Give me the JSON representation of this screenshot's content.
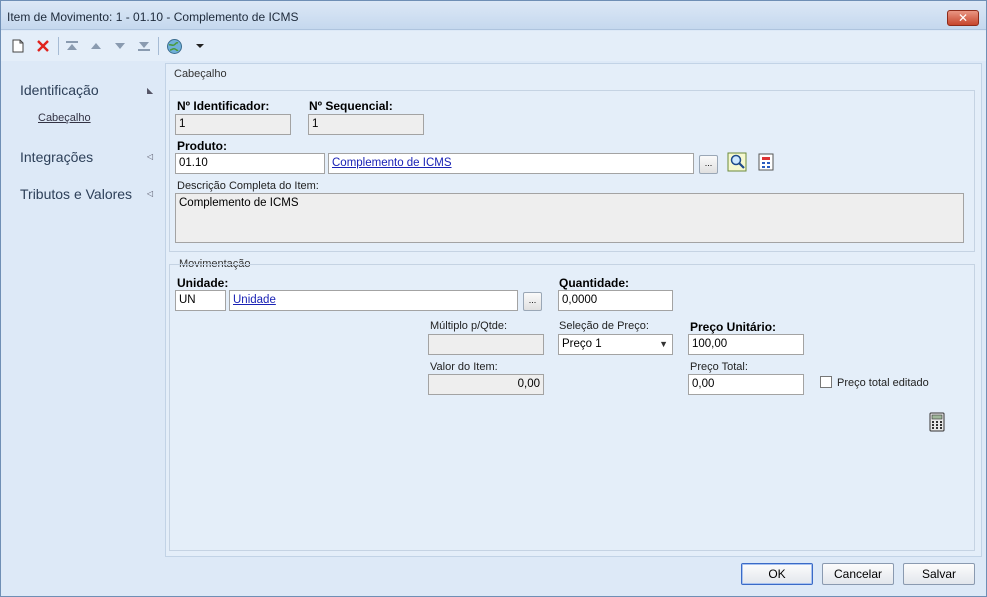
{
  "window": {
    "title": "Item de Movimento: 1 - 01.10 - Complemento de ICMS",
    "close_label": "✕"
  },
  "toolbar": {
    "items": [
      "new-document-icon",
      "delete-icon",
      "first-record-icon",
      "previous-record-icon",
      "next-record-icon",
      "last-record-icon",
      "globe-icon",
      "dropdown-arrow-icon"
    ]
  },
  "sidebar": {
    "items": [
      {
        "label": "Identificação",
        "sub": "Cabeçalho"
      },
      {
        "label": "Integrações"
      },
      {
        "label": "Tributos e Valores"
      }
    ]
  },
  "cabecalho": {
    "group_label": "Cabeçalho",
    "identificador_label": "Nº Identificador:",
    "identificador_value": "1",
    "sequencial_label": "Nº Sequencial:",
    "sequencial_value": "1",
    "produto_label": "Produto:",
    "produto_code": "01.10",
    "produto_name": "Complemento de ICMS",
    "lookup_label": "...",
    "descricao_label": "Descrição Completa do Item:",
    "descricao_value": "Complemento de ICMS"
  },
  "movimentacao": {
    "group_label": "Movimentação",
    "unidade_label": "Unidade:",
    "unidade_code": "UN",
    "unidade_name": "Unidade",
    "lookup_label": "...",
    "quantidade_label": "Quantidade:",
    "quantidade_value": "0,0000",
    "multiplo_label": "Múltiplo p/Qtde:",
    "multiplo_value": "",
    "selecao_label": "Seleção de Preço:",
    "selecao_value": "Preço 1",
    "preco_unitario_label": "Preço Unitário:",
    "preco_unitario_value": "100,00",
    "valor_item_label": "Valor do Item:",
    "valor_item_value": "0,00",
    "preco_total_label": "Preço Total:",
    "preco_total_value": "0,00",
    "preco_editado_label": "Preço total editado"
  },
  "footer": {
    "ok_label": "OK",
    "cancel_label": "Cancelar",
    "save_label": "Salvar"
  }
}
